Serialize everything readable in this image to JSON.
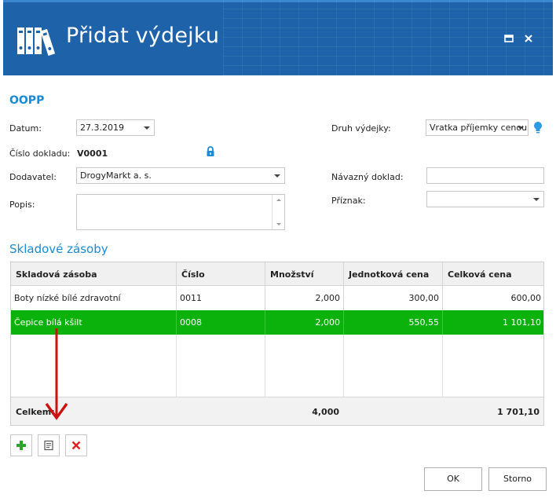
{
  "window": {
    "title": "Přidat výdejku",
    "maximize_icon": "maximize-icon",
    "close_icon": "close-icon"
  },
  "form": {
    "section_title": "OOPP",
    "datum_label": "Datum:",
    "datum_value": "27.3.2019",
    "cislo_label": "Číslo dokladu:",
    "cislo_value": "V0001",
    "dodavatel_label": "Dodavatel:",
    "dodavatel_value": "DrogyMarkt a. s.",
    "popis_label": "Popis:",
    "popis_value": "",
    "druh_label": "Druh výdejky:",
    "druh_value": "Vratka příjemky cenou",
    "navazny_label": "Návazný doklad:",
    "navazny_value": "",
    "priznak_label": "Příznak:",
    "priznak_value": ""
  },
  "stock": {
    "title": "Skladové zásoby",
    "columns": [
      "Skladová zásoba",
      "Číslo",
      "Množství",
      "Jednotková cena",
      "Celková cena"
    ],
    "rows": [
      {
        "item": "Boty nízké bílé zdravotní",
        "number": "0011",
        "qty": "2,000",
        "unit_price": "300,00",
        "total": "600,00"
      },
      {
        "item": "Čepice bílá kšilt",
        "number": "0008",
        "qty": "2,000",
        "unit_price": "550,55",
        "total": "1 101,10"
      }
    ],
    "selected_row": 1,
    "footer": {
      "label": "Celkem:",
      "qty": "4,000",
      "total": "1 701,10"
    }
  },
  "buttons": {
    "ok": "OK",
    "cancel": "Storno"
  },
  "colors": {
    "header_bg": "#1e63a9",
    "accent": "#1a8ad4",
    "selected_row": "#0cb20c",
    "annotation_arrow": "#cc1111"
  }
}
